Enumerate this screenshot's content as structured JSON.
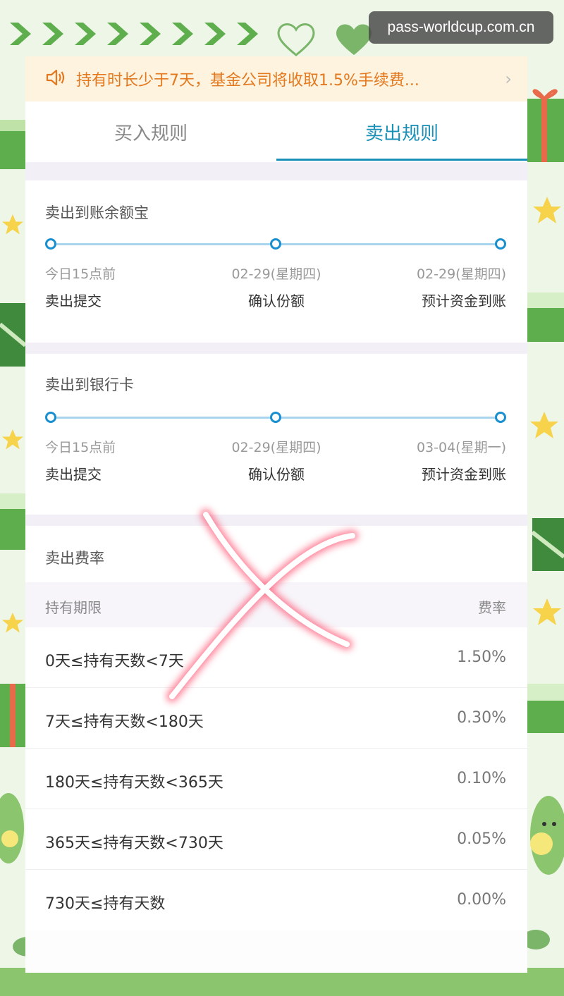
{
  "watermark": "pass-worldcup.com.cn",
  "notice": {
    "text": "持有时长少于7天，基金公司将收取1.5%手续费...",
    "icon": "speaker-icon"
  },
  "tabs": [
    {
      "label": "买入规则",
      "active": false
    },
    {
      "label": "卖出规则",
      "active": true
    }
  ],
  "to_yuebao": {
    "title": "卖出到账余额宝",
    "steps": [
      {
        "date": "今日15点前",
        "label": "卖出提交"
      },
      {
        "date": "02-29(星期四)",
        "label": "确认份额"
      },
      {
        "date": "02-29(星期四)",
        "label": "预计资金到账"
      }
    ]
  },
  "to_bank": {
    "title": "卖出到银行卡",
    "steps": [
      {
        "date": "今日15点前",
        "label": "卖出提交"
      },
      {
        "date": "02-29(星期四)",
        "label": "确认份额"
      },
      {
        "date": "03-04(星期一)",
        "label": "预计资金到账"
      }
    ]
  },
  "fees": {
    "title": "卖出费率",
    "col_period": "持有期限",
    "col_rate": "费率",
    "rows": [
      {
        "period": "0天≤持有天数<7天",
        "rate": "1.50%"
      },
      {
        "period": "7天≤持有天数<180天",
        "rate": "0.30%"
      },
      {
        "period": "180天≤持有天数<365天",
        "rate": "0.10%"
      },
      {
        "period": "365天≤持有天数<730天",
        "rate": "0.05%"
      },
      {
        "period": "730天≤持有天数",
        "rate": "0.00%"
      }
    ]
  },
  "colors": {
    "accent": "#1a8fb8",
    "notice": "#e3781e",
    "cross": "#ff4d6d"
  }
}
